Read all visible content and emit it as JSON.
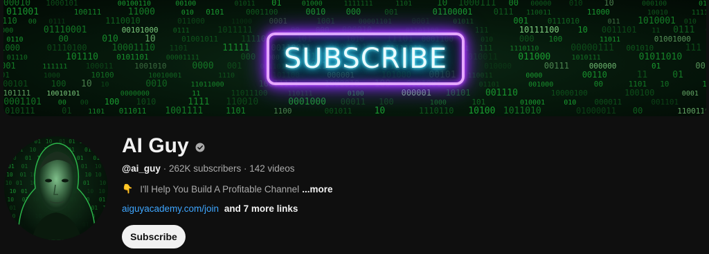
{
  "banner": {
    "text": "SUBSCRIBE"
  },
  "channel": {
    "name": "AI Guy",
    "handle": "@ai_guy",
    "subscribers": "262K subscribers",
    "videos": "142 videos",
    "separator": " · ",
    "description": "I'll Help You Build A Profitable Channel",
    "description_more": "...more",
    "link": "aiguyacademy.com/join",
    "more_links": "and 7 more links",
    "subscribe_label": "Subscribe"
  },
  "icons": {
    "verified": "verified-check-icon",
    "description_emoji": "pointing-down-hand-icon"
  },
  "colors": {
    "background": "#0f0f0f",
    "link": "#3ea6ff",
    "neon_border": "#c04cff",
    "neon_text": "#2fd6ff",
    "matrix_green": "#1fbf3a"
  }
}
